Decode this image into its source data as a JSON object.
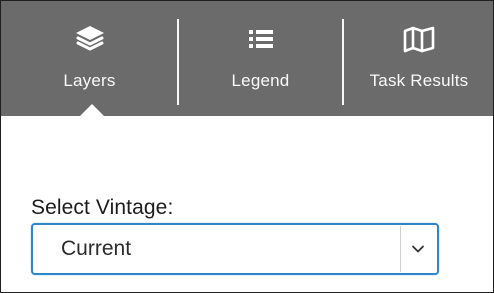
{
  "tabs": [
    {
      "label": "Layers",
      "icon": "layers-icon"
    },
    {
      "label": "Legend",
      "icon": "list-icon"
    },
    {
      "label": "Task Results",
      "icon": "map-icon"
    }
  ],
  "active_tab": "Layers",
  "content": {
    "select_label": "Select Vintage:",
    "select_value": "Current"
  },
  "colors": {
    "tabbar_bg": "#6b6b6b",
    "tab_text": "#ffffff",
    "select_border": "#2f86c9"
  }
}
